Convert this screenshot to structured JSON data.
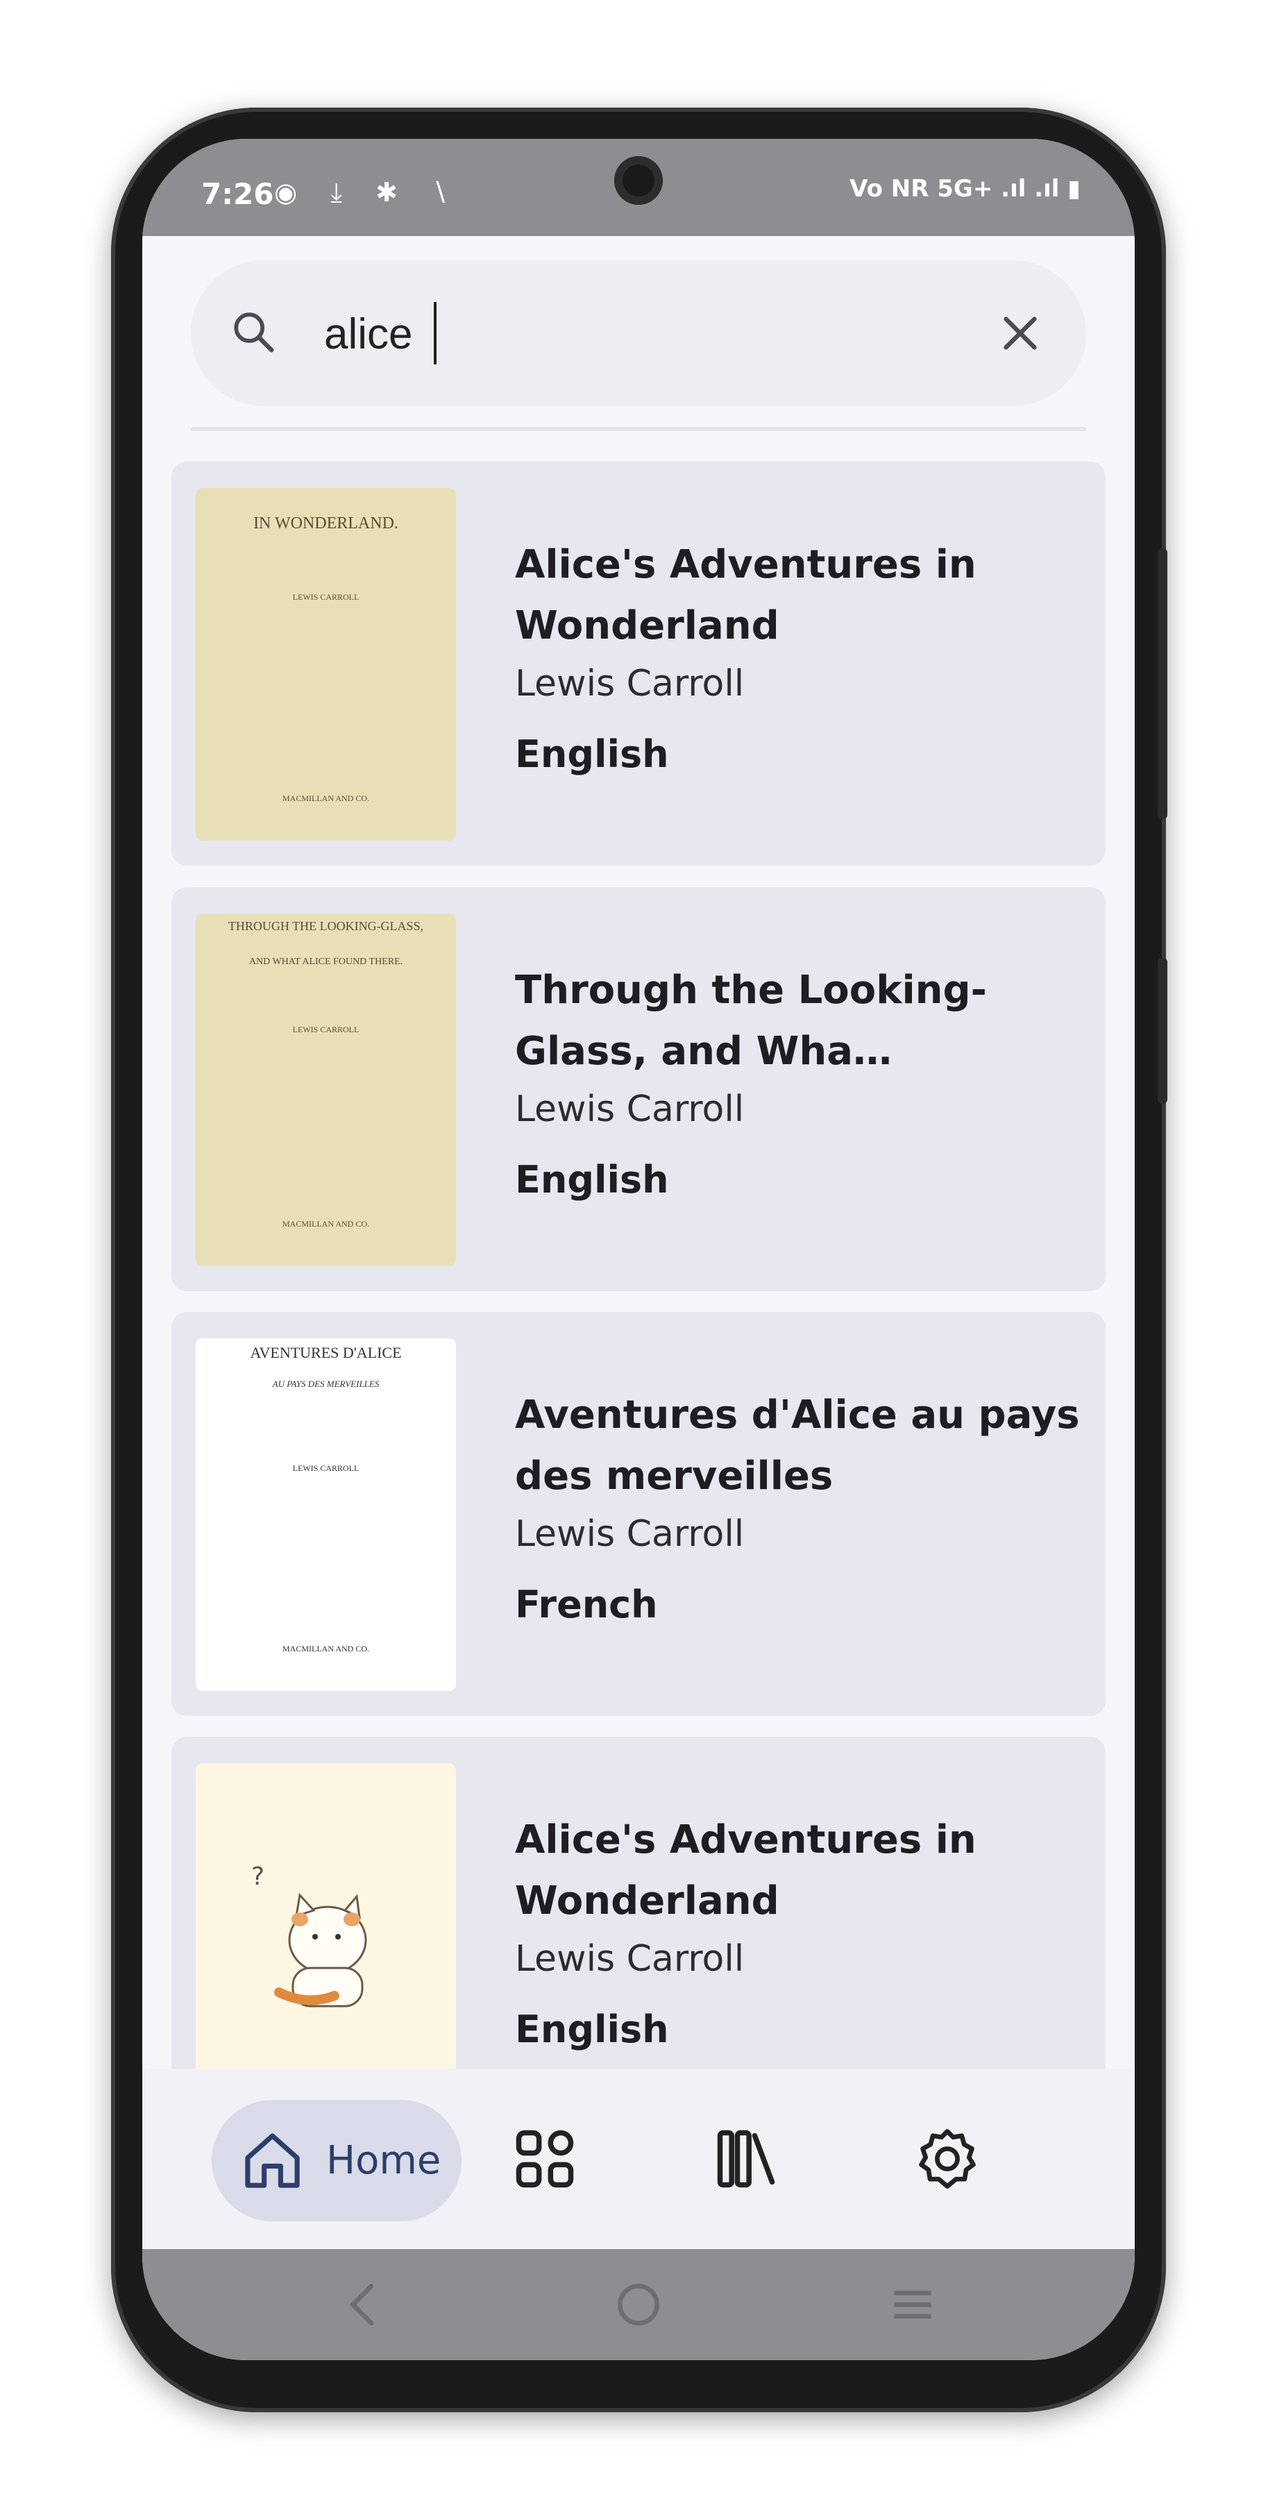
{
  "status_bar": {
    "time": "7:26",
    "left_icons": "◉ ⤓ ✱ ∖",
    "right_icons": "Vo NR 5G+ .ıl .ıl ▮"
  },
  "search": {
    "value": "alice",
    "placeholder": ""
  },
  "results": [
    {
      "title": "Alice's Adventures in Wonderland",
      "author": "Lewis Carroll",
      "language": "English",
      "cover_lines": [
        "IN WONDERLAND.",
        "LEWIS CARROLL",
        "MACMILLAN AND CO."
      ]
    },
    {
      "title": "Through the Looking-Glass, and Wha…",
      "author": "Lewis Carroll",
      "language": "English",
      "cover_lines": [
        "THROUGH THE LOOKING-GLASS,",
        "AND WHAT ALICE FOUND THERE.",
        "LEWIS CARROLL",
        "MACMILLAN AND CO."
      ]
    },
    {
      "title": "Aventures d'Alice au pays des merveilles",
      "author": "Lewis Carroll",
      "language": "French",
      "cover_lines": [
        "AVENTURES D'ALICE",
        "AU PAYS DES MERVEILLES",
        "LEWIS CARROLL",
        "MACMILLAN AND CO."
      ]
    },
    {
      "title": "Alice's Adventures in Wonderland",
      "author": "Lewis Carroll",
      "language": "English",
      "cover_lines": [
        "?"
      ]
    }
  ],
  "bottom_nav": {
    "home_label": "Home",
    "items": [
      "home-icon",
      "grid-icon",
      "library-icon",
      "settings-icon"
    ]
  },
  "colors": {
    "accent": "#2c3e6b",
    "card_bg": "#e7e7f0",
    "status_bar": "#8d8e92"
  }
}
